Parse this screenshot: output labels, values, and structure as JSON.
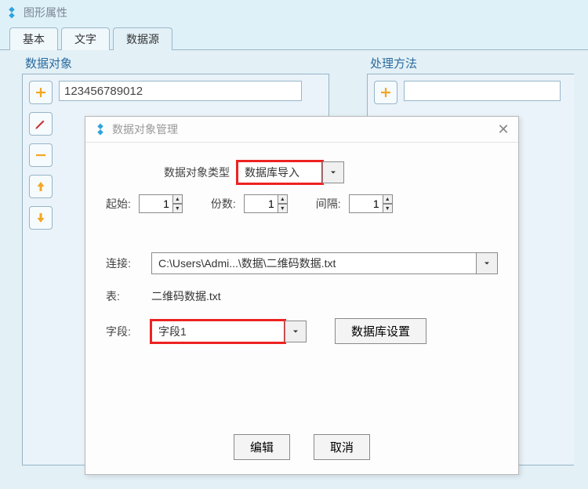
{
  "window": {
    "title": "图形属性"
  },
  "tabs": {
    "basic": "基本",
    "text": "文字",
    "datasource": "数据源"
  },
  "groups": {
    "data_obj": "数据对象",
    "method": "处理方法"
  },
  "data_obj": {
    "value": "123456789012"
  },
  "dialog": {
    "title": "数据对象管理",
    "type_label": "数据对象类型",
    "type_value": "数据库导入",
    "start_label": "起始:",
    "start_value": "1",
    "count_label": "份数:",
    "count_value": "1",
    "interval_label": "间隔:",
    "interval_value": "1",
    "conn_label": "连接:",
    "conn_value": "C:\\Users\\Admi...\\数据\\二维码数据.txt",
    "table_label": "表:",
    "table_value": "二维码数据.txt",
    "field_label": "字段:",
    "field_value": "字段1",
    "db_settings_btn": "数据库设置",
    "edit_btn": "编辑",
    "cancel_btn": "取消"
  }
}
